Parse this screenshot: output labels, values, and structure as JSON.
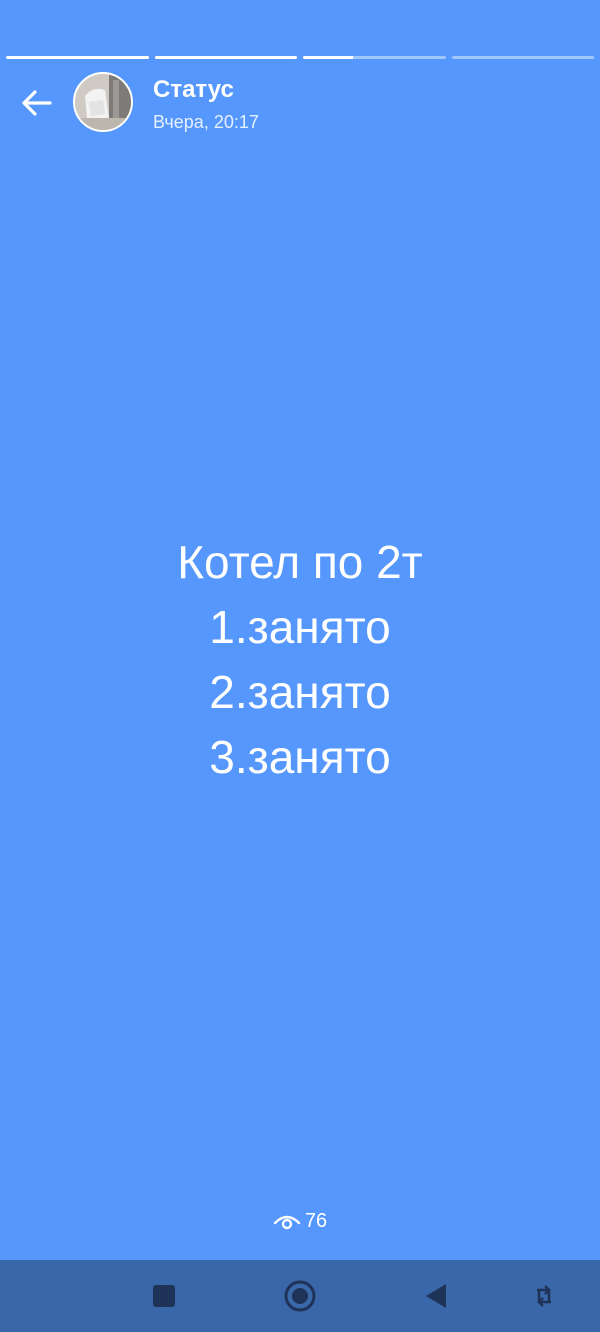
{
  "colors": {
    "background": "#5597FD",
    "navbar": "#3A67A9",
    "text": "#FFFFFF",
    "nav_icon": "#1E3357"
  },
  "progress": {
    "segments": [
      1,
      1,
      0.35,
      0
    ]
  },
  "header": {
    "back_icon": "arrow-left-icon",
    "title": "Статус",
    "time": "Вчера, 20:17"
  },
  "status": {
    "lines": [
      "Котел по 2т",
      "1.занято",
      "2.занято",
      "3.занято"
    ]
  },
  "views": {
    "icon": "eye-icon",
    "count": "76"
  },
  "navbar": {
    "icons": [
      "square-icon",
      "circle-home-icon",
      "triangle-back-icon",
      "rotate-icon"
    ]
  }
}
